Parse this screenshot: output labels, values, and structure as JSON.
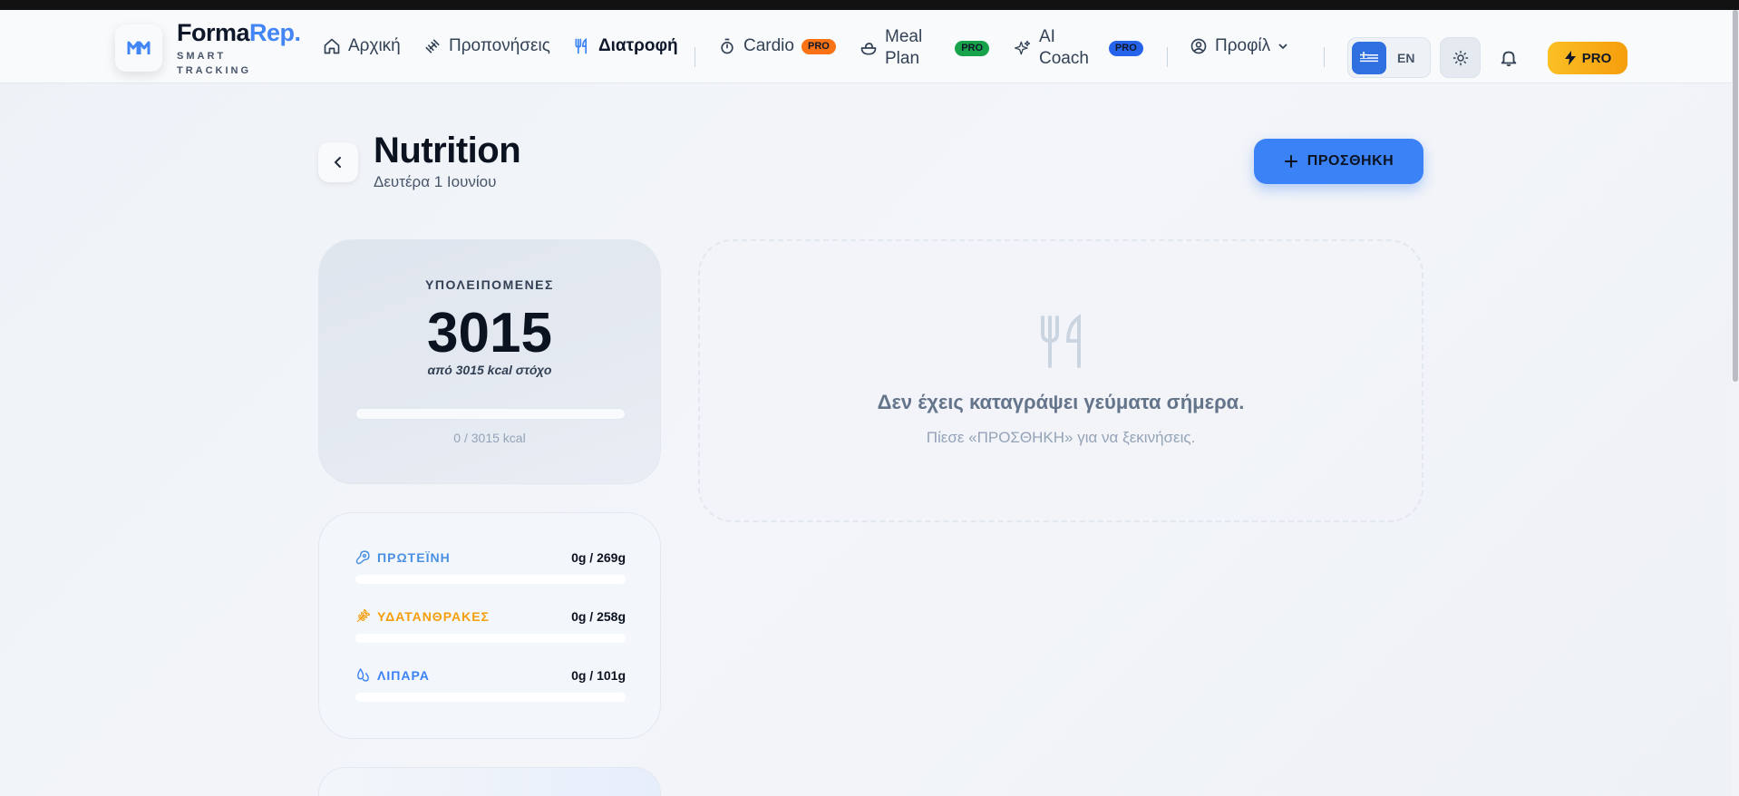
{
  "brand": {
    "name_main": "Forma",
    "name_accent": "Rep.",
    "sub_1": "SMART",
    "sub_2": "TRACKING"
  },
  "nav": {
    "home": "Αρχική",
    "workouts": "Προπονήσεις",
    "nutrition": "Διατροφή",
    "cardio": "Cardio",
    "meal_plan_1": "Meal",
    "meal_plan_2": "Plan",
    "ai_coach_1": "AI",
    "ai_coach_2": "Coach",
    "profile": "Προφίλ",
    "pro_badge": "PRO"
  },
  "badges": {
    "cardio_color": "#f97316",
    "meal_color": "#16a34a",
    "ai_color": "#2563eb"
  },
  "header_actions": {
    "lang_en": "EN",
    "pro_button": "PRO"
  },
  "page": {
    "title": "Nutrition",
    "date": "Δευτέρα 1 Ιουνίου",
    "add_button": "ΠΡΟΣΘΗΚΗ"
  },
  "calories": {
    "label": "ΥΠΟΛΕΙΠΟΜΕΝΕΣ",
    "remaining": "3015",
    "subtitle": "από 3015 kcal στόχο",
    "progress": 0,
    "footer": "0 / 3015 kcal"
  },
  "macros": [
    {
      "name": "ΠΡΩΤΕΪΝΗ",
      "value": "0g / 269g",
      "color": "#4a90e2",
      "progress": 0,
      "icon": "protein-icon"
    },
    {
      "name": "ΥΔΑΤΑΝΘΡΑΚΕΣ",
      "value": "0g / 258g",
      "color": "#f59e0b",
      "progress": 0,
      "icon": "wheat-icon"
    },
    {
      "name": "ΛΙΠΑΡΑ",
      "value": "0g / 101g",
      "color": "#3b82f6",
      "progress": 0,
      "icon": "droplet-icon"
    }
  ],
  "empty_state": {
    "title": "Δεν έχεις καταγράψει γεύματα σήμερα.",
    "subtitle": "Πίεσε «ΠΡΟΣΘΗΚΗ» για να ξεκινήσεις."
  }
}
